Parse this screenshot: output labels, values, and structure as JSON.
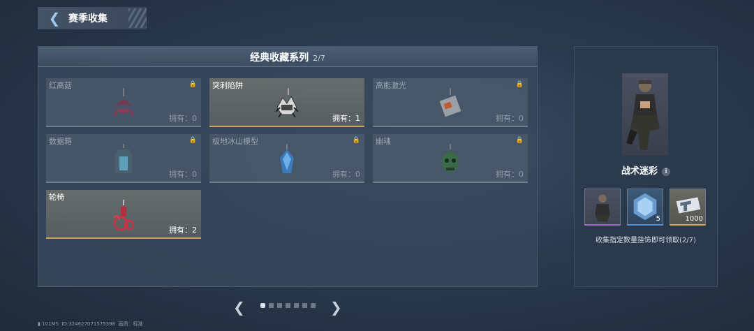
{
  "header": {
    "title": "赛季收集"
  },
  "collection": {
    "title": "经典收藏系列",
    "count": "2/7"
  },
  "items": [
    {
      "name": "红高菇",
      "owned": "拥有：0",
      "locked": true
    },
    {
      "name": "突刺陷阱",
      "owned": "拥有：1",
      "locked": false
    },
    {
      "name": "高能激光",
      "owned": "拥有：0",
      "locked": true
    },
    {
      "name": "数据箱",
      "owned": "拥有：0",
      "locked": true
    },
    {
      "name": "极地冰山模型",
      "owned": "拥有：0",
      "locked": true
    },
    {
      "name": "幽魂",
      "owned": "拥有：0",
      "locked": true
    },
    {
      "name": "轮椅",
      "owned": "拥有：2",
      "locked": false
    }
  ],
  "reward": {
    "name": "战术迷彩",
    "items": [
      {
        "count": ""
      },
      {
        "count": "5"
      },
      {
        "count": "1000"
      }
    ],
    "desc": "收集指定数量挂饰即可领取(2/7)"
  },
  "pagination": {
    "pages": 7,
    "current": 1
  },
  "footer": {
    "ping": "101MS",
    "id": "ID:324627071575398",
    "quality": "画质：标准"
  },
  "colors": {
    "accent_gold": "#c9a45a",
    "accent_blue": "#9ec9f0"
  }
}
